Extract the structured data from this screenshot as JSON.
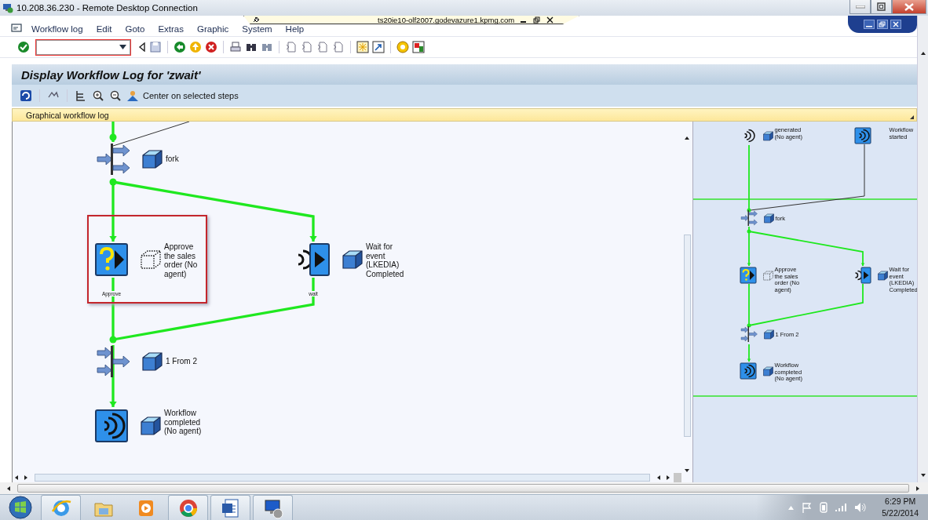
{
  "window": {
    "title": "10.208.36.230 - Remote Desktop Connection"
  },
  "connection_bar": {
    "host": "ts20ie10-olf2007.godevazure1.kpmg.com"
  },
  "menu": [
    {
      "label": "Workflow log"
    },
    {
      "label": "Edit"
    },
    {
      "label": "Goto"
    },
    {
      "label": "Extras"
    },
    {
      "label": "Graphic"
    },
    {
      "label": "System"
    },
    {
      "label": "Help"
    }
  ],
  "page_title": "Display Workflow Log for 'zwait'",
  "app_toolbar": {
    "center_button": "Center on selected steps"
  },
  "panel_title": "Graphical workflow log",
  "diagram": {
    "nodes": [
      {
        "kind": "fork",
        "label": "fork",
        "object": {
          "dotted": false
        },
        "selected": false
      },
      {
        "kind": "task",
        "label": "Approve the sales order (No agent)",
        "caption": "Approve",
        "object": {
          "dotted": true
        },
        "selected": true
      },
      {
        "kind": "wait",
        "label": "Wait for event (LKEDIA) Completed",
        "caption": "wait",
        "object": {
          "dotted": false
        },
        "selected": false
      },
      {
        "kind": "join",
        "label": "1 From 2",
        "object": {
          "dotted": false
        },
        "selected": false
      },
      {
        "kind": "end",
        "label": "Workflow completed (No agent)",
        "object": {
          "dotted": false
        },
        "selected": false
      }
    ]
  },
  "overview": {
    "nodes": [
      {
        "kind": "generated",
        "label": "generated (No agent)",
        "object": {
          "dotted": false
        }
      },
      {
        "kind": "start",
        "label": "Workflow started"
      },
      {
        "kind": "fork",
        "label": "fork",
        "object": {
          "dotted": false
        }
      },
      {
        "kind": "task",
        "label": "Approve the sales order (No agent)",
        "object": {
          "dotted": true
        }
      },
      {
        "kind": "wait",
        "label": "Wait for event (LKEDIA) Completed",
        "object": {
          "dotted": false
        }
      },
      {
        "kind": "join",
        "label": "1 From 2",
        "object": {
          "dotted": false
        }
      },
      {
        "kind": "end",
        "label": "Workflow completed (No agent)",
        "object": {
          "dotted": false
        }
      }
    ]
  },
  "taskbar": {
    "time": "6:29 PM",
    "date": "5/22/2014"
  }
}
